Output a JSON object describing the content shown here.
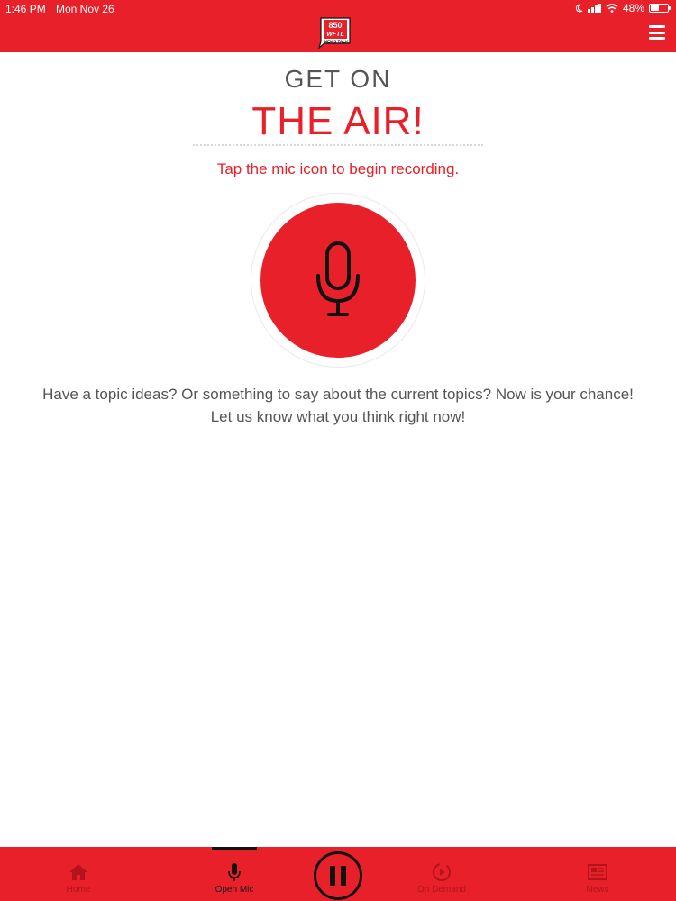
{
  "status_bar": {
    "time": "1:46 PM",
    "date": "Mon Nov 26",
    "battery": "48%",
    "battery_level": 0.48
  },
  "header": {
    "logo": {
      "number": "850",
      "call_sign": "WFTL",
      "tagline": "NEWS TALK"
    },
    "menu_icon": "hamburger-menu-icon"
  },
  "hero": {
    "line1": "GET ON",
    "line2": "THE AIR!",
    "instruction": "Tap the mic icon to begin recording.",
    "mic_icon": "microphone-icon"
  },
  "description": "Have a topic ideas? Or something to say about the current topics?  Now is your chance!  Let us know what you think right now!",
  "tabs": [
    {
      "label": "Home",
      "icon": "home-icon",
      "active": false
    },
    {
      "label": "Open Mic",
      "icon": "microphone-icon",
      "active": true
    },
    {
      "label": "On Demand",
      "icon": "on-demand-icon",
      "active": false
    },
    {
      "label": "News",
      "icon": "newspaper-icon",
      "active": false
    }
  ],
  "player": {
    "state": "playing",
    "icon": "pause-icon"
  },
  "colors": {
    "brand_red": "#e8202a",
    "text_gray": "#555555",
    "dark": "#111111"
  }
}
